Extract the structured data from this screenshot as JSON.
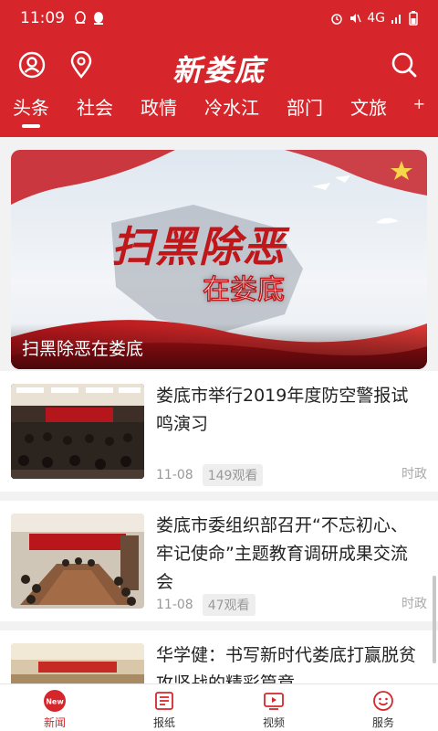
{
  "statusbar": {
    "time": "11:09",
    "network": "4G"
  },
  "header": {
    "logo_text": "新娄底",
    "tabs": [
      "头条",
      "社会",
      "政情",
      "冷水江",
      "部门",
      "文旅"
    ],
    "more_label": "+"
  },
  "hero": {
    "art_title": "扫黑除恶",
    "art_subtitle": "在娄底",
    "caption": "扫黑除恶在娄底"
  },
  "news": [
    {
      "title": "娄底市举行2019年度防空警报试鸣演习",
      "date": "11-08",
      "views": "149观看",
      "category": "时政"
    },
    {
      "title": "娄底市委组织部召开“不忘初心、牢记使命”主题教育调研成果交流会",
      "date": "11-08",
      "views": "47观看",
      "category": "时政"
    },
    {
      "title": "华学健：书写新时代娄底打赢脱贫攻坚战的精彩篇章",
      "date": "",
      "views": "",
      "category": ""
    }
  ],
  "bottomnav": {
    "items": [
      {
        "label": "新闻",
        "badge": "New"
      },
      {
        "label": "报纸"
      },
      {
        "label": "视频"
      },
      {
        "label": "服务"
      }
    ]
  },
  "colors": {
    "brand_red": "#d7262b",
    "background": "#f2f2f2"
  }
}
